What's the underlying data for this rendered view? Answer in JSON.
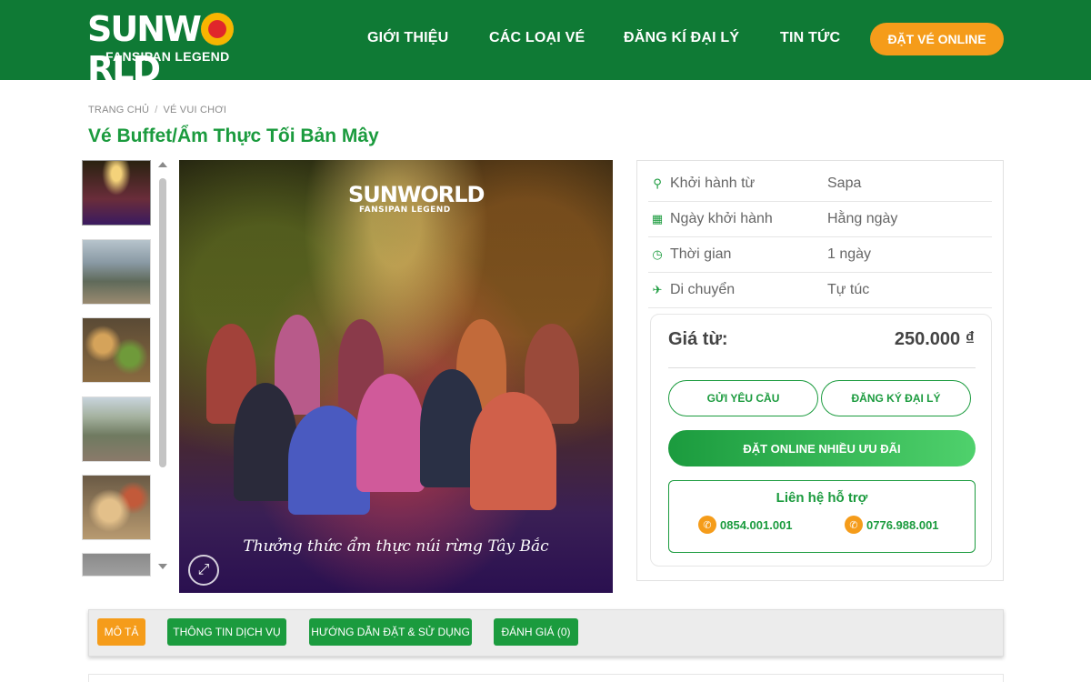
{
  "brand": {
    "logo_main_left": "SUNW",
    "logo_main_right": "RLD",
    "logo_sub": "FANSIPAN LEGEND",
    "colors": {
      "primary_green": "#0f7a35",
      "accent_green": "#1b9b3e",
      "accent_orange": "#f59c1a"
    }
  },
  "nav": {
    "items": [
      {
        "label": "GIỚI THIỆU"
      },
      {
        "label": "CÁC LOẠI VÉ"
      },
      {
        "label": "ĐĂNG KÍ ĐẠI LÝ"
      },
      {
        "label": "TIN TỨC"
      }
    ],
    "cta_label": "ĐẶT VÉ ONLINE"
  },
  "breadcrumb": {
    "home": "TRANG CHỦ",
    "separator": "/",
    "current": "VÉ VUI CHƠI"
  },
  "product": {
    "title": "Vé Buffet/Ẩm Thực Tối Bản Mây",
    "hero_logo_main": "SUNWORLD",
    "hero_logo_sub": "FANSIPAN LEGEND",
    "hero_caption": "Thưởng thức ẩm thực núi rừng Tây Bắc",
    "thumbnail_count": 6
  },
  "info": {
    "rows": [
      {
        "icon": "map-marker-icon",
        "label": "Khởi hành từ",
        "value": "Sapa"
      },
      {
        "icon": "calendar-icon",
        "label": "Ngày khởi hành",
        "value": "Hằng ngày"
      },
      {
        "icon": "clock-icon",
        "label": "Thời gian",
        "value": "1 ngày"
      },
      {
        "icon": "plane-icon",
        "label": "Di chuyển",
        "value": "Tự túc"
      }
    ],
    "price_label": "Giá từ:",
    "price_value": "250.000 ₫",
    "request_button": "GỬI YÊU CẦU",
    "agent_button": "ĐĂNG KÝ ĐẠI LÝ",
    "book_button": "ĐẶT ONLINE NHIỀU ƯU ĐÃI",
    "support_title": "Liên hệ hỗ trợ",
    "phones": [
      "0854.001.001",
      "0776.988.001"
    ]
  },
  "tabs": [
    {
      "label": "MÔ TẢ",
      "active": true
    },
    {
      "label": "THÔNG TIN DỊCH VỤ",
      "active": false
    },
    {
      "label": "HƯỚNG DẪN ĐẶT & SỬ DỤNG",
      "active": false
    },
    {
      "label": "ĐÁNH GIÁ (0)",
      "active": false
    }
  ]
}
